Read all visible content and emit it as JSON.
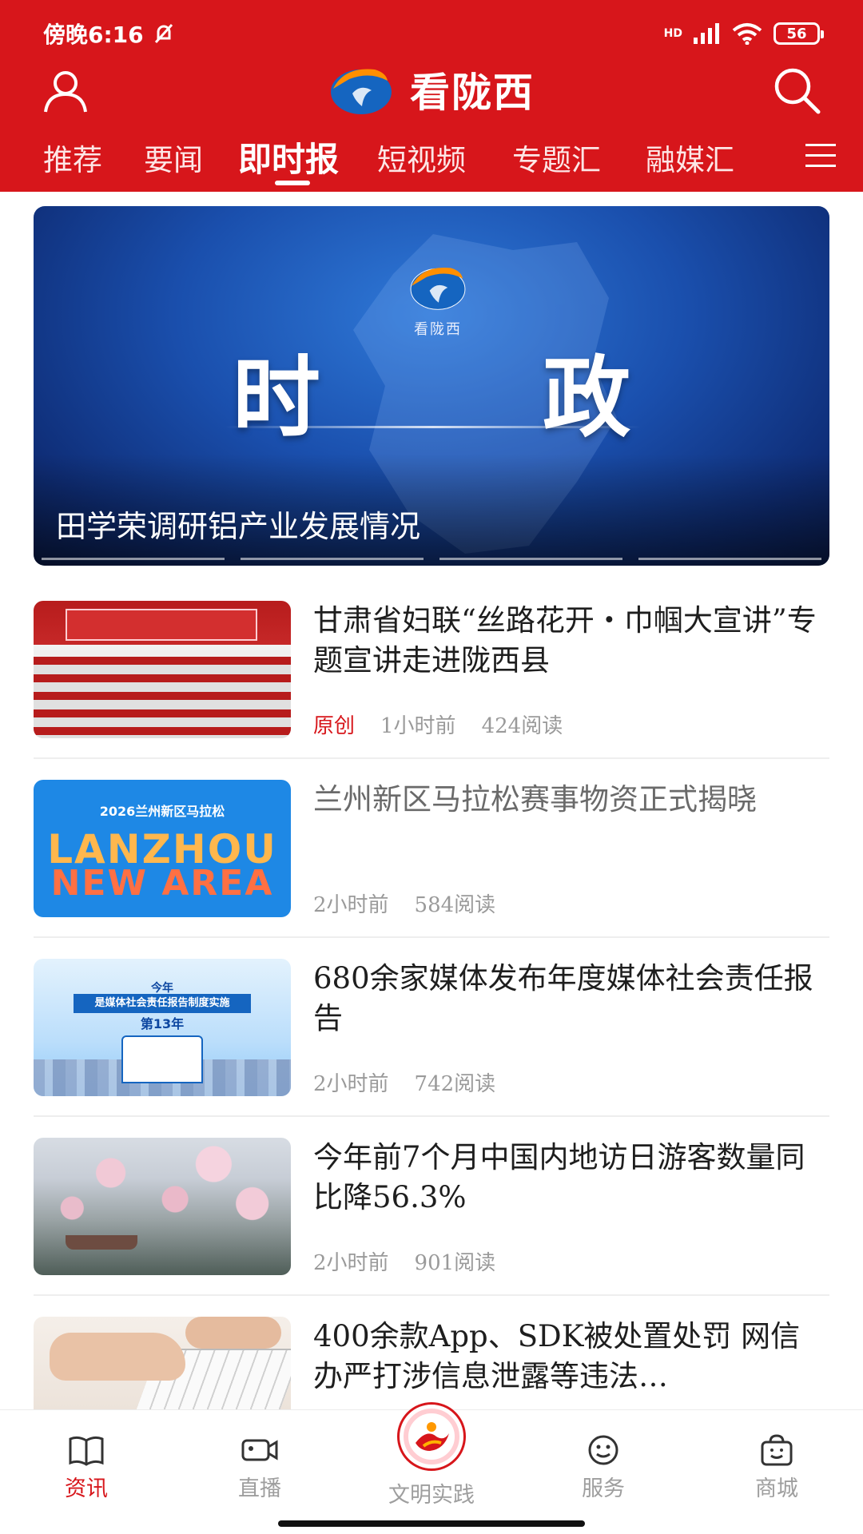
{
  "status_bar": {
    "time": "傍晚6:16",
    "battery": "56",
    "network": "HD"
  },
  "header": {
    "app_title": "看陇西",
    "tabs": [
      "推荐",
      "要闻",
      "即时报",
      "短视频",
      "专题汇",
      "融媒汇"
    ],
    "active_tab": "即时报"
  },
  "banner": {
    "logo_text": "看陇西",
    "big_title": "时 政",
    "caption": "田学荣调研铝产业发展情况",
    "slide_count": 4
  },
  "news": [
    {
      "title": "甘肃省妇联“丝路花开・巾帼大宣讲”专题宣讲走进陇西县",
      "tag": "原创",
      "time": "1小时前",
      "reads": "424阅读",
      "read": false
    },
    {
      "title": "兰州新区马拉松赛事物资正式揭晓",
      "tag": "",
      "time": "2小时前",
      "reads": "584阅读",
      "read": true,
      "thumb_text": {
        "top": "2026兰州新区马拉松",
        "l1": "LANZHOU",
        "l2": "NEW AREA"
      }
    },
    {
      "title": "680余家媒体发布年度媒体社会责任报告",
      "tag": "",
      "time": "2小时前",
      "reads": "742阅读",
      "read": false,
      "thumb_text": {
        "t1": "今年",
        "band": "是媒体社会责任报告制度实施",
        "t2": "第13年"
      }
    },
    {
      "title": "今年前7个月中国内地访日游客数量同比降56.3%",
      "tag": "",
      "time": "2小时前",
      "reads": "901阅读",
      "read": false
    },
    {
      "title": "400余款App、SDK被处置处罚 网信办严打涉信息泄露等违法…",
      "tag": "",
      "time": "",
      "reads": "",
      "read": false
    }
  ],
  "bottom_nav": [
    {
      "label": "资讯",
      "icon": "book-icon",
      "active": true
    },
    {
      "label": "直播",
      "icon": "video-camera-icon",
      "active": false
    },
    {
      "label": "文明实践",
      "icon": "emblem-icon",
      "active": false
    },
    {
      "label": "服务",
      "icon": "smile-icon",
      "active": false
    },
    {
      "label": "商城",
      "icon": "shopping-bag-icon",
      "active": false
    }
  ],
  "colors": {
    "brand_red": "#d7161b",
    "muted_text": "#9a9a9a"
  }
}
